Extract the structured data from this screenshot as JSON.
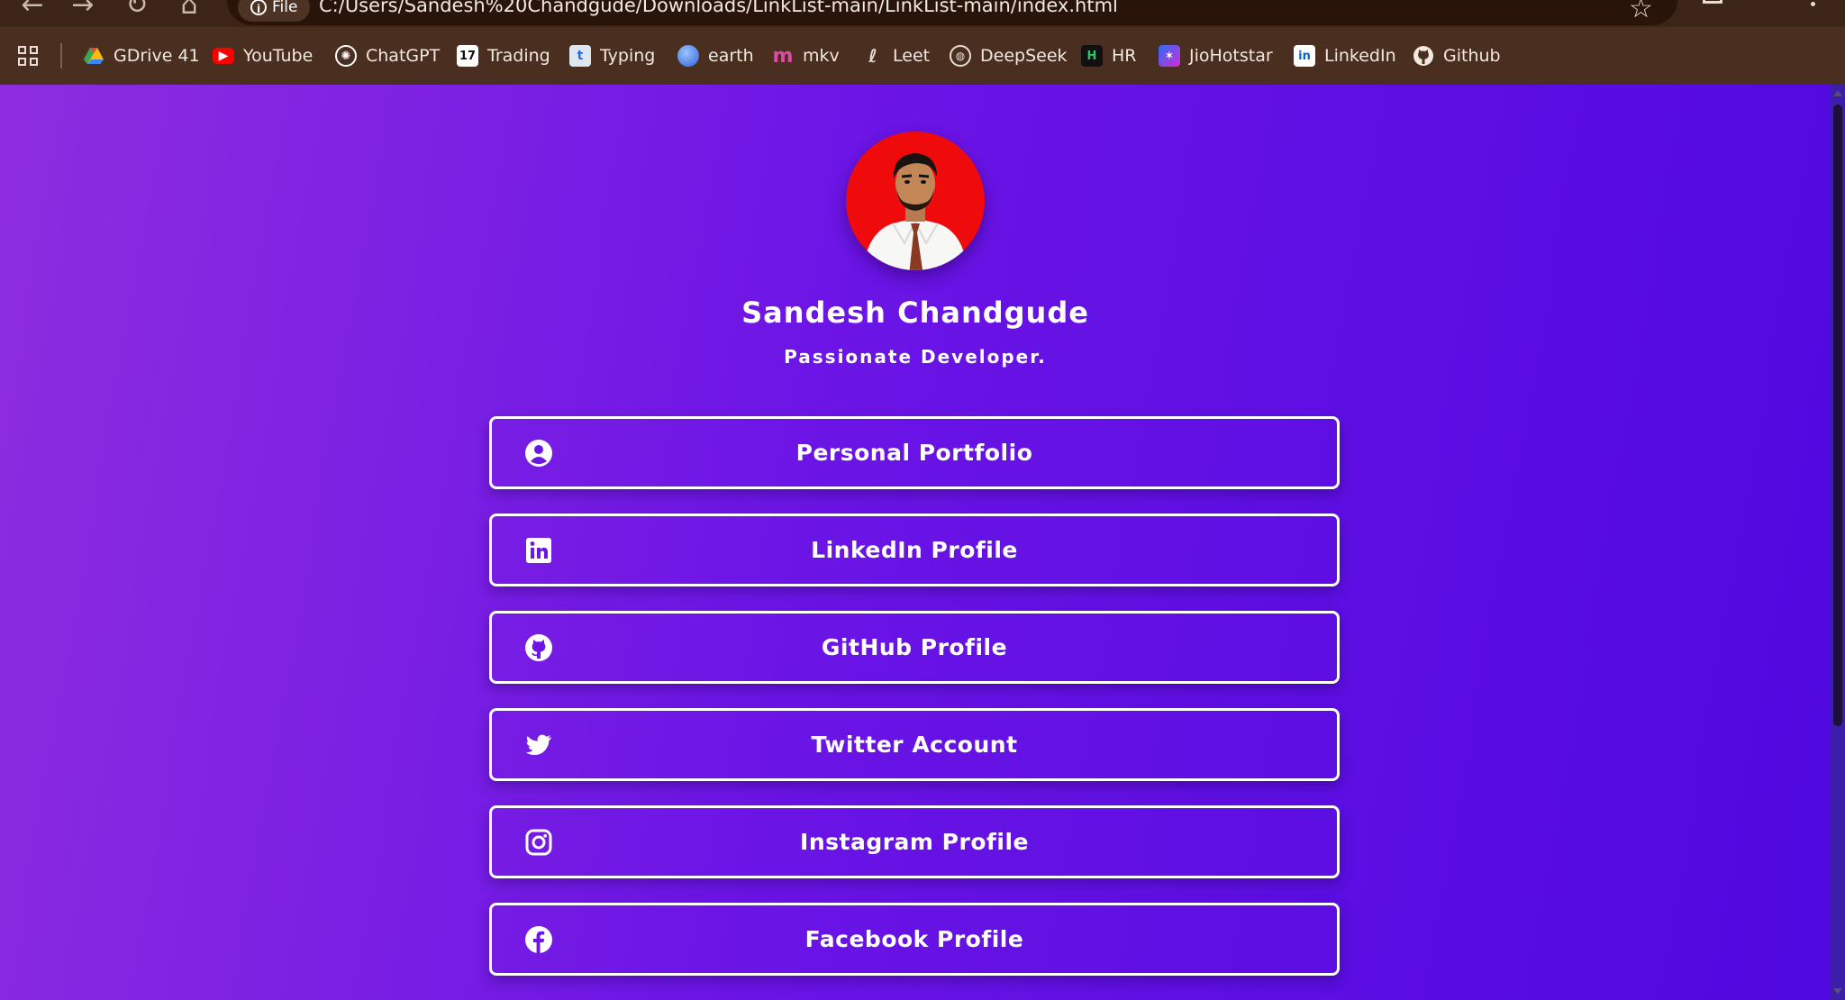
{
  "browser": {
    "site_chip": "File",
    "url": "C:/Users/Sandesh%20Chandgude/Downloads/LinkList-main/LinkList-main/index.html",
    "bookmarks": [
      {
        "label": "GDrive 41",
        "icon": "drive-icon"
      },
      {
        "label": "YouTube",
        "icon": "youtube-icon"
      },
      {
        "label": "ChatGPT",
        "icon": "chatgpt-icon"
      },
      {
        "label": "Trading",
        "icon": "tradingview-icon"
      },
      {
        "label": "Typing",
        "icon": "typing-icon"
      },
      {
        "label": "earth",
        "icon": "earth-icon"
      },
      {
        "label": "mkv",
        "icon": "mkv-icon"
      },
      {
        "label": "Leet",
        "icon": "leetcode-icon"
      },
      {
        "label": "DeepSeek",
        "icon": "globe-icon"
      },
      {
        "label": "HR",
        "icon": "hackerrank-icon"
      },
      {
        "label": "JioHotstar",
        "icon": "jiohotstar-icon"
      },
      {
        "label": "LinkedIn",
        "icon": "linkedin-icon"
      },
      {
        "label": "Github",
        "icon": "github-icon"
      }
    ]
  },
  "profile": {
    "name": "Sandesh Chandgude",
    "tagline": "Passionate Developer.",
    "avatar_bg": "#ef0b0b"
  },
  "links": [
    {
      "label": "Personal Portfolio",
      "icon": "user-circle-icon"
    },
    {
      "label": "LinkedIn Profile",
      "icon": "linkedin-icon"
    },
    {
      "label": "GitHub Profile",
      "icon": "github-icon"
    },
    {
      "label": "Twitter Account",
      "icon": "twitter-icon"
    },
    {
      "label": "Instagram Profile",
      "icon": "instagram-icon"
    },
    {
      "label": "Facebook Profile",
      "icon": "facebook-icon"
    }
  ],
  "colors": {
    "gradient_start": "#8e2ddf",
    "gradient_end": "#4f08e0",
    "toolbar": "#3c2416",
    "bookmark_bar": "#4a2e1f"
  }
}
